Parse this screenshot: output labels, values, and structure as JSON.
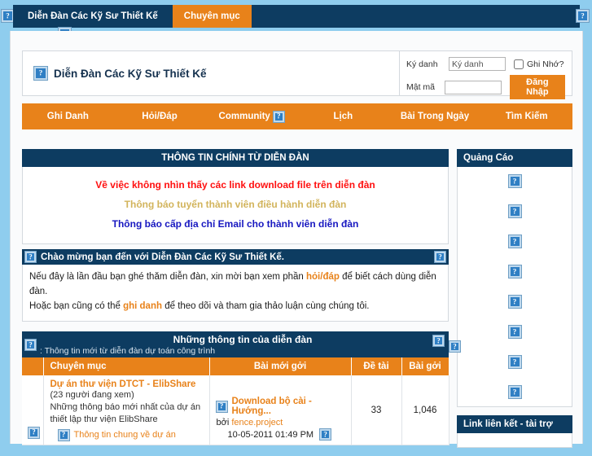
{
  "topbar": {
    "home_tab": "Diễn Đàn Các Kỹ Sư Thiết Kế",
    "active_tab": "Chuyên mục",
    "left_icon": "broken-image-icon",
    "right_icon": "broken-image-icon",
    "below_icon": "broken-image-icon"
  },
  "site_header": {
    "logo_icon": "broken-image-icon",
    "brand": "Diễn Đàn Các Kỹ Sư Thiết Kế",
    "login": {
      "username_label": "Ký danh",
      "username_value": "Ký danh",
      "username_placeholder": "Ký danh",
      "password_label": "Mật mã",
      "password_value": "",
      "remember_label": "Ghi Nhớ?",
      "remember_checked": false,
      "submit_label": "Đăng Nhập"
    }
  },
  "nav": {
    "items": [
      {
        "label": "Ghi Danh",
        "icon": null
      },
      {
        "label": "Hỏi/Đáp",
        "icon": null
      },
      {
        "label": "Community",
        "icon": "broken-image-icon"
      },
      {
        "label": "Lịch",
        "icon": null
      },
      {
        "label": "Bài Trong Ngày",
        "icon": null
      },
      {
        "label": "Tìm Kiếm",
        "icon": null
      }
    ]
  },
  "main": {
    "announce_panel": {
      "title": "THÔNG TIN CHÍNH TỪ DIỄN ĐÀN",
      "items": [
        {
          "text": "Về việc không nhìn thấy các link download file trên diễn đàn",
          "color": "#ff1010"
        },
        {
          "text": "Thông báo tuyển thành viên điều hành diễn đàn",
          "color": "#d2b45c"
        },
        {
          "text": "Thông báo cấp địa chỉ Email cho thành viên diễn đàn",
          "color": "#1717c0"
        }
      ]
    },
    "welcome": {
      "icon_left": "broken-image-icon",
      "icon_right": "broken-image-icon",
      "title": "Chào mừng bạn đến với Diễn Đàn Các Kỹ Sư Thiết Kế.",
      "line1_a": "Nếu đây là lần đầu bạn ghé thăm diễn đàn, xin mời bạn xem phần ",
      "line1_link": "hỏi/đáp",
      "line1_b": " để biết cách dùng diễn đàn.",
      "line2_a": "Hoặc bạn cũng có thể ",
      "line2_link": "ghi danh",
      "line2_b": " để theo dõi và tham gia thảo luận cùng chúng tôi."
    },
    "forum": {
      "title": "Những thông tin của diễn đàn",
      "subtitle": ": Thông tin mới từ diễn đàn dự toán công trình",
      "icon_left": "broken-image-icon",
      "icon_right": "broken-image-icon",
      "icon_outer": "broken-image-icon",
      "columns": [
        "",
        "Chuyên mục",
        "Bài mới gởi",
        "Đề tài",
        "Bài gởi"
      ],
      "rows": [
        {
          "status_icon": "broken-image-icon",
          "category_title": "Dự án thư viện DTCT - ElibShare",
          "category_viewers": "(23 người đang xem)",
          "category_desc_line1": "Những thông báo mới nhất của dự án",
          "category_desc_line2": "thiết lập thư viện ElibShare",
          "subforum_icon": "broken-image-icon",
          "subforum_label": "Thông tin chung về dự án",
          "lastpost_icon": "broken-image-icon",
          "lastpost_title": "Download bộ cài - Hướng...",
          "lastpost_by_label": "bởi",
          "lastpost_user": "fence.project",
          "lastpost_date": "10-05-2011 01:49 PM",
          "lastpost_date_icon": "broken-image-icon",
          "topics": "33",
          "posts": "1,046"
        }
      ]
    }
  },
  "sidebar": {
    "ads_panel": {
      "title": "Quảng Cáo",
      "ad_icons": [
        "broken-image-icon",
        "broken-image-icon",
        "broken-image-icon",
        "broken-image-icon",
        "broken-image-icon",
        "broken-image-icon",
        "broken-image-icon",
        "broken-image-icon"
      ]
    },
    "links_panel": {
      "title": "Link liên kết - tài trợ"
    }
  }
}
